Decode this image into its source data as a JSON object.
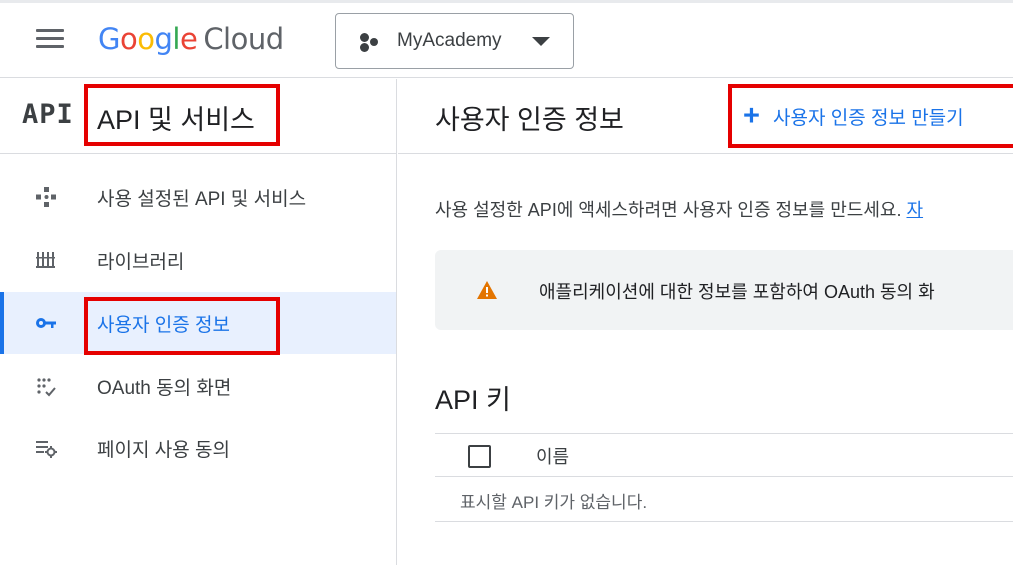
{
  "header": {
    "logo": {
      "letters": [
        "G",
        "o",
        "o",
        "g",
        "l",
        "e"
      ],
      "product": "Cloud"
    },
    "project": {
      "name": "MyAcademy"
    }
  },
  "sidebar": {
    "api_logo": "API",
    "title": "API 및 서비스",
    "items": [
      {
        "label": "사용 설정된 API 및 서비스",
        "icon": "enabled-apis-icon",
        "active": false
      },
      {
        "label": "라이브러리",
        "icon": "library-icon",
        "active": false
      },
      {
        "label": "사용자 인증 정보",
        "icon": "key-icon",
        "active": true
      },
      {
        "label": "OAuth 동의 화면",
        "icon": "oauth-consent-icon",
        "active": false
      },
      {
        "label": "페이지 사용 동의",
        "icon": "page-usage-icon",
        "active": false
      }
    ]
  },
  "main": {
    "title": "사용자 인증 정보",
    "create_button": "사용자 인증 정보 만들기",
    "description": "사용 설정한 API에 액세스하려면 사용자 인증 정보를 만드세요.",
    "description_link": "자",
    "notice": "애플리케이션에 대한 정보를 포함하여 OAuth 동의 화",
    "api_keys": {
      "title": "API 키",
      "column_name": "이름",
      "empty_text": "표시할 API 키가 없습니다."
    }
  },
  "colors": {
    "accent": "#1a73e8",
    "highlight_box": "#e50000",
    "warning": "#e37400"
  }
}
